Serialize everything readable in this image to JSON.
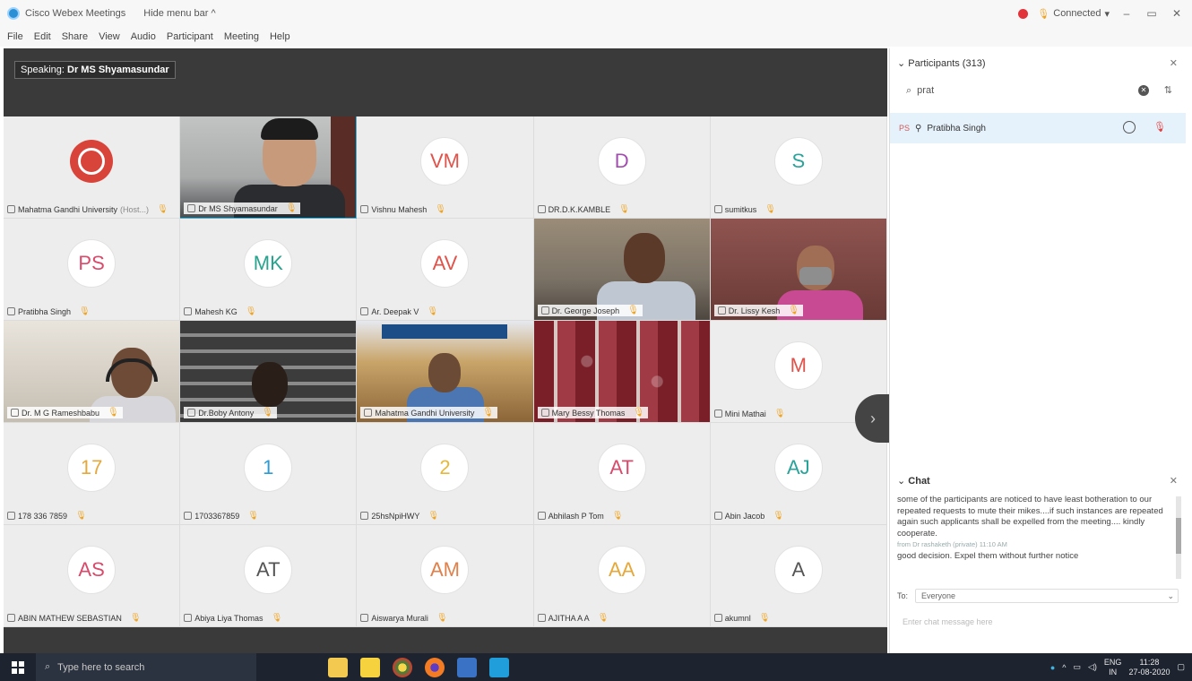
{
  "window": {
    "title": "Cisco Webex Meetings",
    "hide_menu": "Hide menu bar ^",
    "status": "Connected",
    "status_caret": "▾",
    "rec_icon": "record-icon",
    "buttons": {
      "minimize": "–",
      "restore": "▭",
      "close": "✕"
    }
  },
  "menu": [
    "File",
    "Edit",
    "Share",
    "View",
    "Audio",
    "Participant",
    "Meeting",
    "Help"
  ],
  "speaking": {
    "prefix": "Speaking:",
    "name": "Dr MS Shyamasundar"
  },
  "tiles": [
    {
      "name": "Mahatma Gandhi University",
      "suffix": "(Host...)",
      "kind": "logo"
    },
    {
      "name": "Dr MS Shyamasundar",
      "kind": "video-speaker",
      "active": true
    },
    {
      "name": "Vishnu Mahesh",
      "initials": "VM",
      "color": "#e0524a"
    },
    {
      "name": "DR.D.K.KAMBLE",
      "initials": "D",
      "color": "#a24db0"
    },
    {
      "name": "sumitkus",
      "initials": "S",
      "color": "#2aa39a"
    },
    {
      "name": "Pratibha Singh",
      "initials": "PS",
      "color": "#d94a6b"
    },
    {
      "name": "Mahesh KG",
      "initials": "MK",
      "color": "#27a38e"
    },
    {
      "name": "Ar. Deepak V",
      "initials": "AV",
      "color": "#e0524a"
    },
    {
      "name": "Dr. George Joseph",
      "kind": "video-george"
    },
    {
      "name": "Dr. Lissy Kesh",
      "kind": "video-lissy"
    },
    {
      "name": "Dr. M G Rameshbabu",
      "kind": "video-ramesh"
    },
    {
      "name": "Dr.Boby Antony",
      "kind": "video-boby"
    },
    {
      "name": "Mahatma Gandhi University",
      "kind": "video-mgu"
    },
    {
      "name": "Mary Bessy Thomas",
      "kind": "video-mary"
    },
    {
      "name": "Mini Mathai",
      "initials": "M",
      "color": "#e0524a"
    },
    {
      "name": "178 336 7859",
      "initials": "17",
      "color": "#e6a83a"
    },
    {
      "name": "1703367859",
      "initials": "1",
      "color": "#2c9bd6"
    },
    {
      "name": "25hsNpiHWY",
      "initials": "2",
      "color": "#e6b83a"
    },
    {
      "name": "Abhilash P Tom",
      "initials": "AT",
      "color": "#d94a6b"
    },
    {
      "name": "Abin Jacob",
      "initials": "AJ",
      "color": "#2aa39a"
    },
    {
      "name": "ABIN MATHEW SEBASTIAN",
      "initials": "AS",
      "color": "#d94a6b"
    },
    {
      "name": "Abiya Liya Thomas",
      "initials": "AT",
      "color": "#555555"
    },
    {
      "name": "Aiswarya Murali",
      "initials": "AM",
      "color": "#e0804a"
    },
    {
      "name": "AJITHA A A",
      "initials": "AA",
      "color": "#e6a83a"
    },
    {
      "name": "akumnl",
      "initials": "A",
      "color": "#555555"
    }
  ],
  "panel": {
    "participants_title": "Participants (313)",
    "search_value": "prat",
    "participant": {
      "initials": "PS",
      "name": "Pratibha Singh"
    },
    "chat_title": "Chat",
    "chat_messages": [
      "some of the participants are noticed to have least botheration to our repeated requests to  mute their mikes....if such instances are repeated again such applicants shall be expelled from the meeting.... kindly cooperate.",
      "from Dr rashaketh (private) 11:10 AM",
      "good decision. Expel them without further notice"
    ],
    "to_label": "To:",
    "to_value": "Everyone",
    "chat_placeholder": "Enter chat message here"
  },
  "taskbar": {
    "search_placeholder": "Type here to search",
    "lang": "ENG",
    "region": "IN",
    "time": "11:28",
    "date": "27-08-2020"
  }
}
